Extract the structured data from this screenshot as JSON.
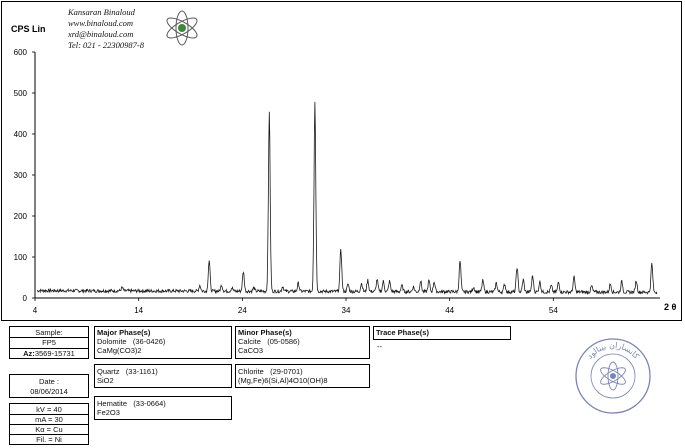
{
  "header": {
    "company": "Kansaran Binaloud",
    "website": "www.binaloud.com",
    "email": "xrd@binaloud.com",
    "phone": "Tel: 021 - 22300987-8"
  },
  "chart_data": {
    "type": "line",
    "ylabel": "CPS Lin",
    "xlabel": "2 θ",
    "xlim": [
      4,
      64
    ],
    "ylim": [
      0,
      600
    ],
    "x_ticks": [
      4,
      14,
      24,
      34,
      44,
      54
    ],
    "y_ticks": [
      0,
      100,
      200,
      300,
      400,
      500,
      600
    ],
    "grid": false,
    "line_color": "#1a1a1a",
    "baseline": 14,
    "peaks": [
      [
        12.4,
        8
      ],
      [
        19.9,
        14
      ],
      [
        20.8,
        75
      ],
      [
        22.0,
        15
      ],
      [
        23.0,
        8
      ],
      [
        24.1,
        48
      ],
      [
        25.1,
        8
      ],
      [
        26.6,
        440
      ],
      [
        27.9,
        12
      ],
      [
        29.4,
        20
      ],
      [
        31.0,
        465
      ],
      [
        33.5,
        105
      ],
      [
        34.2,
        18
      ],
      [
        35.5,
        20
      ],
      [
        36.1,
        28
      ],
      [
        37.0,
        30
      ],
      [
        37.6,
        25
      ],
      [
        38.2,
        25
      ],
      [
        39.4,
        15
      ],
      [
        40.5,
        12
      ],
      [
        41.2,
        26
      ],
      [
        42.0,
        27
      ],
      [
        42.5,
        25
      ],
      [
        45.0,
        75
      ],
      [
        46.3,
        12
      ],
      [
        47.2,
        27
      ],
      [
        48.5,
        22
      ],
      [
        49.3,
        19
      ],
      [
        50.5,
        60
      ],
      [
        51.1,
        30
      ],
      [
        52.0,
        40
      ],
      [
        52.7,
        25
      ],
      [
        53.8,
        15
      ],
      [
        54.5,
        24
      ],
      [
        56.0,
        36
      ],
      [
        57.7,
        15
      ],
      [
        59.5,
        20
      ],
      [
        60.6,
        26
      ],
      [
        62.0,
        28
      ],
      [
        63.5,
        70
      ]
    ]
  },
  "info": {
    "sample_label": "Sample:",
    "sample_value": "FP5",
    "az_label": "Az:",
    "az_value": "3569-15731",
    "date_label": "Date :",
    "date_value": "08/06/2014",
    "kv": "kV = 40",
    "ma": "mA = 30",
    "ka": "Kα = Cu",
    "fil": "Fil. = Ni"
  },
  "phases": {
    "major_title": "Major Phase(s)",
    "dolomite_name": "Dolomite",
    "dolomite_code": "(36-0426)",
    "dolomite_formula": "CaMg(CO3)2",
    "quartz_name": "Quartz",
    "quartz_code": "(33-1161)",
    "quartz_formula": "SiO2",
    "hematite_name": "Hematite",
    "hematite_code": "(33-0664)",
    "hematite_formula": "Fe2O3",
    "minor_title": "Minor Phase(s)",
    "calcite_name": "Calcite",
    "calcite_code": "(05-0586)",
    "calcite_formula": "CaCO3",
    "chlorite_name": "Chlorite",
    "chlorite_code": "(29-0701)",
    "chlorite_formula": "(Mg,Fe)6(Si,Al)4O10(OH)8",
    "trace_title": "Trace Phase(s)",
    "trace_value": "--"
  },
  "stamp": {
    "color": "#7a84b8",
    "text": "کانساران بینالود"
  }
}
